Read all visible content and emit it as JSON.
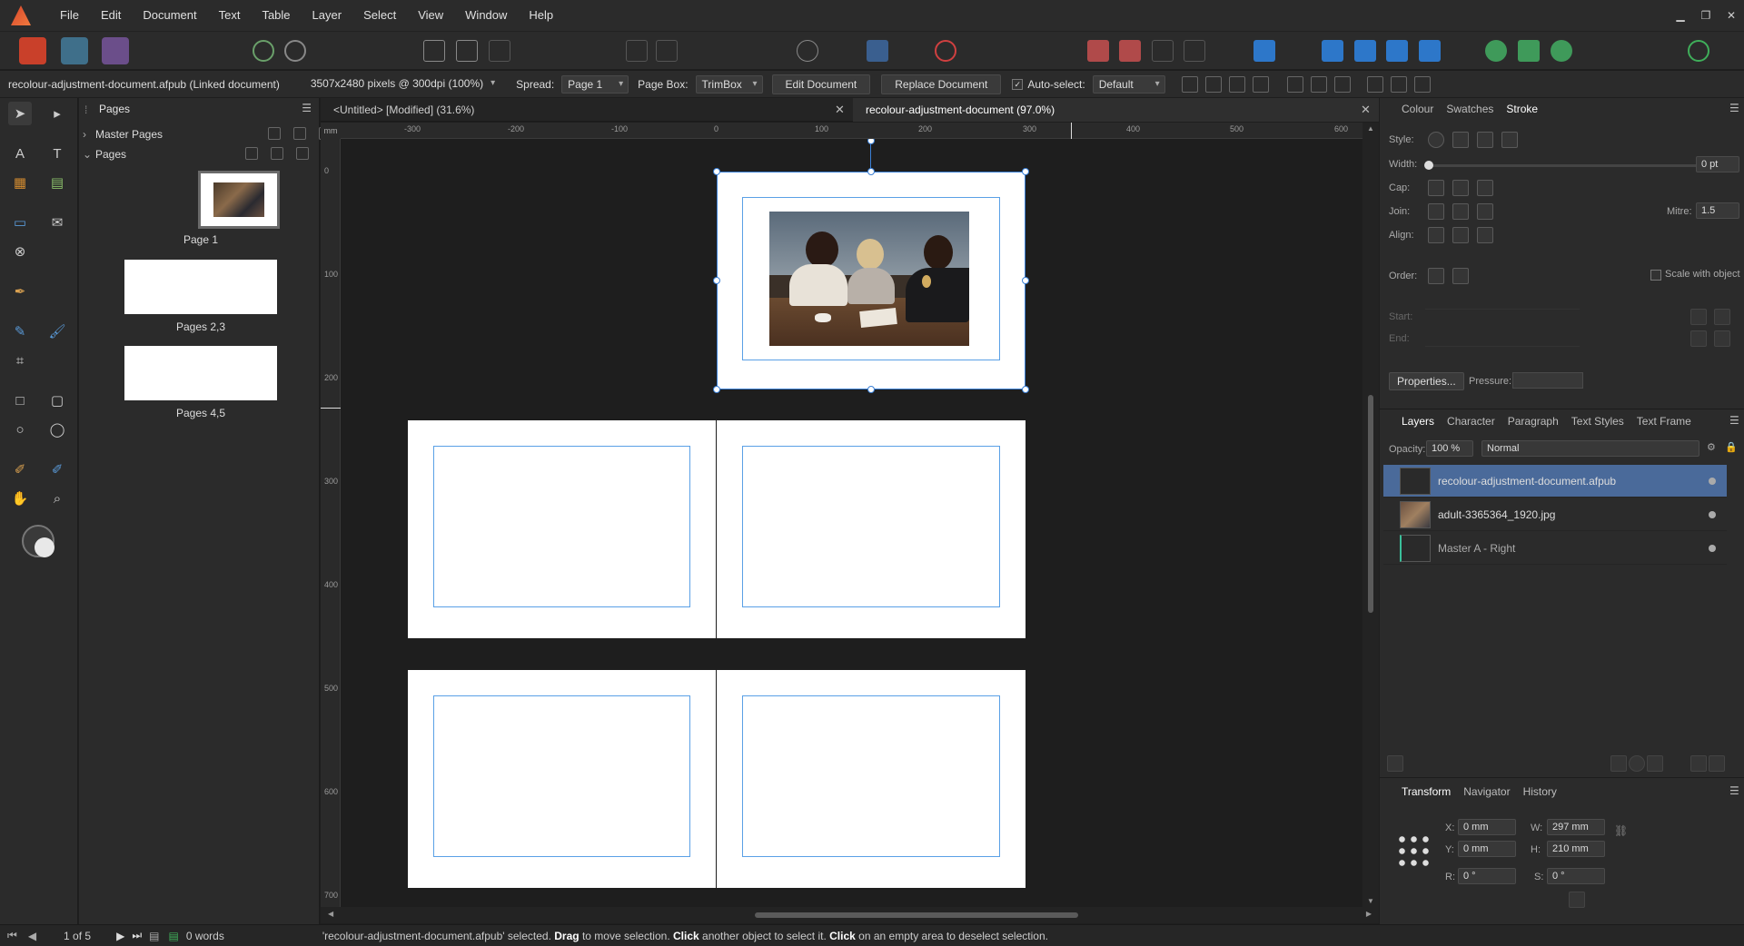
{
  "menu": [
    "File",
    "Edit",
    "Document",
    "Text",
    "Table",
    "Layer",
    "Select",
    "View",
    "Window",
    "Help"
  ],
  "context": {
    "doc_info": "recolour-adjustment-document.afpub (Linked document)",
    "pixels": "3507x2480 pixels @ 300dpi (100%)",
    "spread_label": "Spread:",
    "spread_value": "Page 1",
    "pagebox_label": "Page Box:",
    "pagebox_value": "TrimBox",
    "edit_document": "Edit Document",
    "replace_document": "Replace Document",
    "autoselect_label": "Auto-select:",
    "autoselect_value": "Default"
  },
  "pages_panel": {
    "tab": "Pages",
    "master_pages": "Master Pages",
    "pages": "Pages",
    "thumbs": [
      "Page 1",
      "Pages 2,3",
      "Pages 4,5"
    ]
  },
  "doc_tabs": [
    {
      "label": "<Untitled> [Modified] (31.6%)"
    },
    {
      "label": "recolour-adjustment-document (97.0%)"
    }
  ],
  "ruler": {
    "unit": "mm",
    "h_ticks": [
      "-300",
      "-200",
      "-100",
      "0",
      "100",
      "200",
      "300",
      "400",
      "500",
      "600"
    ],
    "v_ticks": [
      "0",
      "100",
      "200",
      "300",
      "400",
      "500",
      "600",
      "700"
    ]
  },
  "stroke_panel": {
    "tabs": [
      "Colour",
      "Swatches",
      "Stroke"
    ],
    "style_label": "Style:",
    "width_label": "Width:",
    "width_value": "0 pt",
    "cap_label": "Cap:",
    "join_label": "Join:",
    "align_label": "Align:",
    "mitre_label": "Mitre:",
    "mitre_value": "1.5",
    "order_label": "Order:",
    "scale_label": "Scale with object",
    "start_label": "Start:",
    "end_label": "End:",
    "properties_label": "Properties...",
    "pressure_label": "Pressure:"
  },
  "layers_panel": {
    "tabs": [
      "Layers",
      "Character",
      "Paragraph",
      "Text Styles",
      "Text Frame"
    ],
    "opacity_label": "Opacity:",
    "opacity_value": "100 %",
    "blend_value": "Normal",
    "layers": [
      {
        "name": "recolour-adjustment-document.afpub"
      },
      {
        "name": "adult-3365364_1920.jpg"
      },
      {
        "name": "Master A - Right"
      }
    ]
  },
  "transform_panel": {
    "tabs": [
      "Transform",
      "Navigator",
      "History"
    ],
    "x_label": "X:",
    "x_value": "0 mm",
    "y_label": "Y:",
    "y_value": "0 mm",
    "w_label": "W:",
    "w_value": "297 mm",
    "h_label": "H:",
    "h_value": "210 mm",
    "r_label": "R:",
    "r_value": "0 °",
    "s_label": "S:",
    "s_value": "0 °"
  },
  "status": {
    "page_counter": "1 of 5",
    "words": "0 words",
    "msg_1": "'recolour-adjustment-document.afpub' selected.",
    "msg_drag": "Drag",
    "msg_2": "to move selection.",
    "msg_click": "Click",
    "msg_3": "another object to select it.",
    "msg_click2": "Click",
    "msg_4": "on an empty area to deselect selection."
  },
  "colors": {
    "accent": "#4a6a9a",
    "margin_guide": "#5aa0e6",
    "panel_bg": "#2b2b2b",
    "canvas_bg": "#1e1e1e"
  }
}
